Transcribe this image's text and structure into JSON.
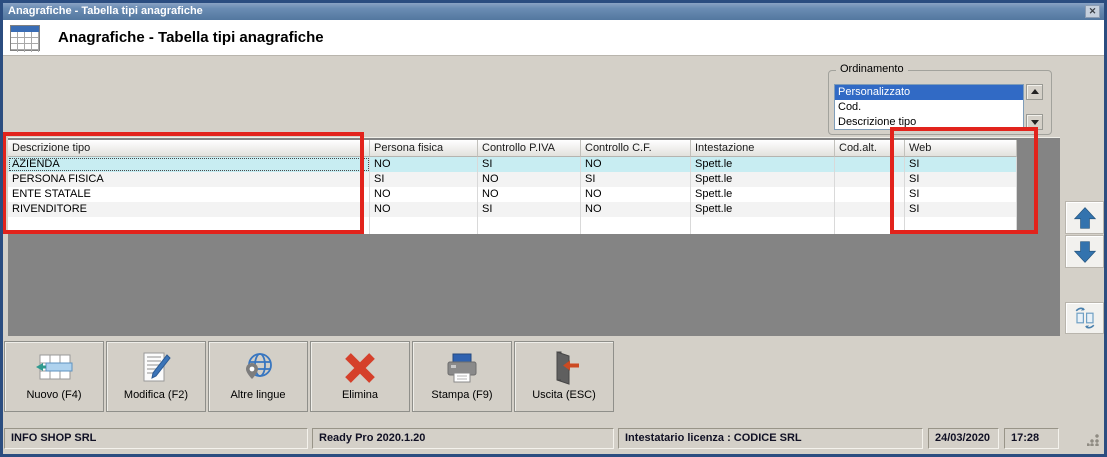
{
  "window": {
    "title": "Anagrafiche - Tabella tipi anagrafiche",
    "close_glyph": "✕"
  },
  "header": {
    "title": "Anagrafiche - Tabella tipi anagrafiche",
    "icon": "table-grid-icon"
  },
  "ordinamento": {
    "label": "Ordinamento",
    "options": [
      "Personalizzato",
      "Cod.",
      "Descrizione tipo"
    ],
    "selected": "Personalizzato"
  },
  "table": {
    "columns": [
      "Descrizione tipo",
      "Persona fisica",
      "Controllo P.IVA",
      "Controllo C.F.",
      "Intestazione",
      "Cod.alt.",
      "Web"
    ],
    "rows": [
      [
        "AZIENDA",
        "NO",
        "SI",
        "NO",
        "Spett.le",
        "",
        "SI"
      ],
      [
        "PERSONA FISICA",
        "SI",
        "NO",
        "SI",
        "Spett.le",
        "",
        "SI"
      ],
      [
        "ENTE STATALE",
        "NO",
        "NO",
        "NO",
        "Spett.le",
        "",
        "SI"
      ],
      [
        "RIVENDITORE",
        "NO",
        "SI",
        "NO",
        "Spett.le",
        "",
        "SI"
      ]
    ],
    "selected_row_index": 0
  },
  "highlights": {
    "note": "red annotation rectangles on 'Descrizione tipo' column and 'Web' column",
    "color": "#e2231c"
  },
  "side_buttons": [
    {
      "icon": "arrow-up-icon"
    },
    {
      "icon": "arrow-down-icon"
    },
    {
      "icon": "swap-records-icon"
    }
  ],
  "toolbar": {
    "buttons": [
      {
        "label": "Nuovo (F4)",
        "icon": "table-insert-row-icon"
      },
      {
        "label": "Modifica (F2)",
        "icon": "edit-pencil-document-icon"
      },
      {
        "label": "Altre lingue",
        "icon": "globe-pin-icon"
      },
      {
        "label": "Elimina",
        "icon": "red-x-icon"
      },
      {
        "label": "Stampa (F9)",
        "icon": "printer-icon"
      },
      {
        "label": "Uscita (ESC)",
        "icon": "exit-door-icon"
      }
    ]
  },
  "statusbar": {
    "company": "INFO SHOP SRL",
    "version": "Ready Pro 2020.1.20",
    "license": "Intestatario licenza : CODICE SRL",
    "date": "24/03/2020",
    "time": "17:28"
  },
  "colors": {
    "titlebar_blue": "#5d82ad",
    "window_border_blue": "#2b4d80",
    "background_gray": "#d4d0c8",
    "table_surround_gray": "#848484",
    "selection_cyan": "#c8edf2",
    "listbox_selection_blue": "#316ac5",
    "annotation_red": "#e2231c",
    "nav_arrow_blue": "#3373ae"
  }
}
